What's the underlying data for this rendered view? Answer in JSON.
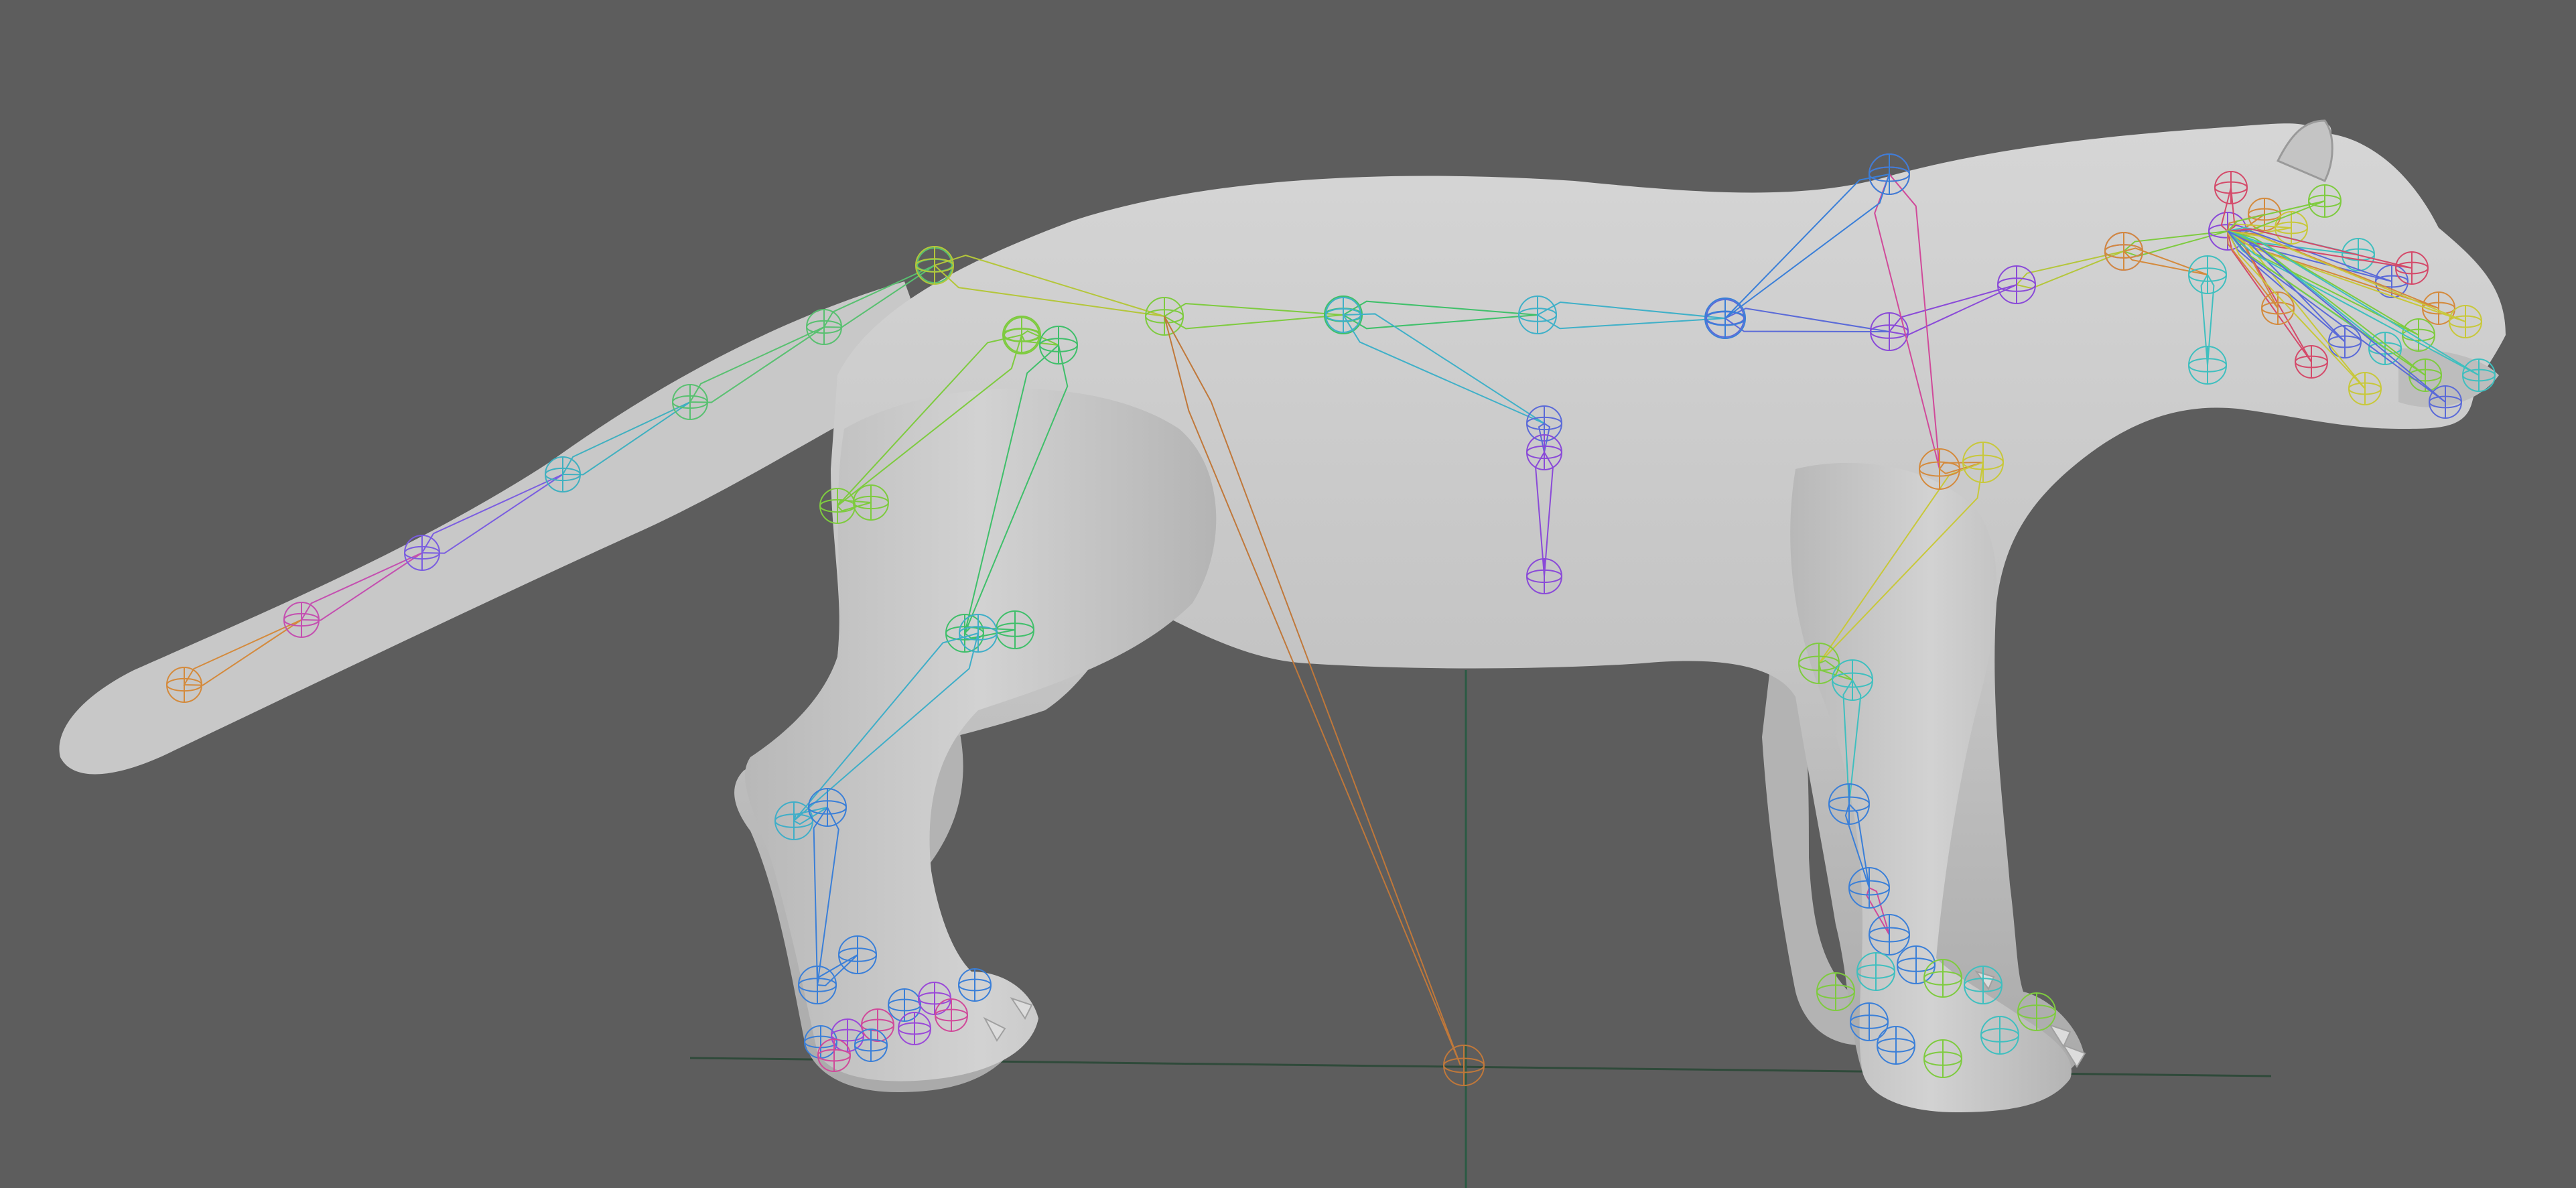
{
  "viewport": {
    "background_color": "#5d5d5d",
    "mesh_color": "#c9c9c9",
    "shading_color": "#a8a8a8",
    "grid_color": "#2f4a3a",
    "origin_color": "#2a5a44"
  },
  "rig": {
    "bone_colors": {
      "tail": [
        "#d48a3c",
        "#c44fb0",
        "#7a5de0",
        "#3fb0c0",
        "#58c070"
      ],
      "hind_leg": [
        "#7ecb3f",
        "#3fbf6a",
        "#3faec8",
        "#3a7fd8",
        "#9a49d8",
        "#d04a9a"
      ],
      "spine": [
        "#b4c63a",
        "#7ecb3f",
        "#3fc06a",
        "#3fb0c8",
        "#5a6ad8",
        "#8a4ad8"
      ],
      "front_leg": [
        "#d04a9a",
        "#d48a3c",
        "#c8c83a",
        "#7ecb3f",
        "#3fbfbf",
        "#3a7fd8"
      ],
      "neck_head": [
        "#d44a6a",
        "#d48a3c",
        "#c8c83a",
        "#7ecb3f",
        "#3fbfbf",
        "#5a6ad8"
      ],
      "pole": "#c0783a"
    }
  }
}
